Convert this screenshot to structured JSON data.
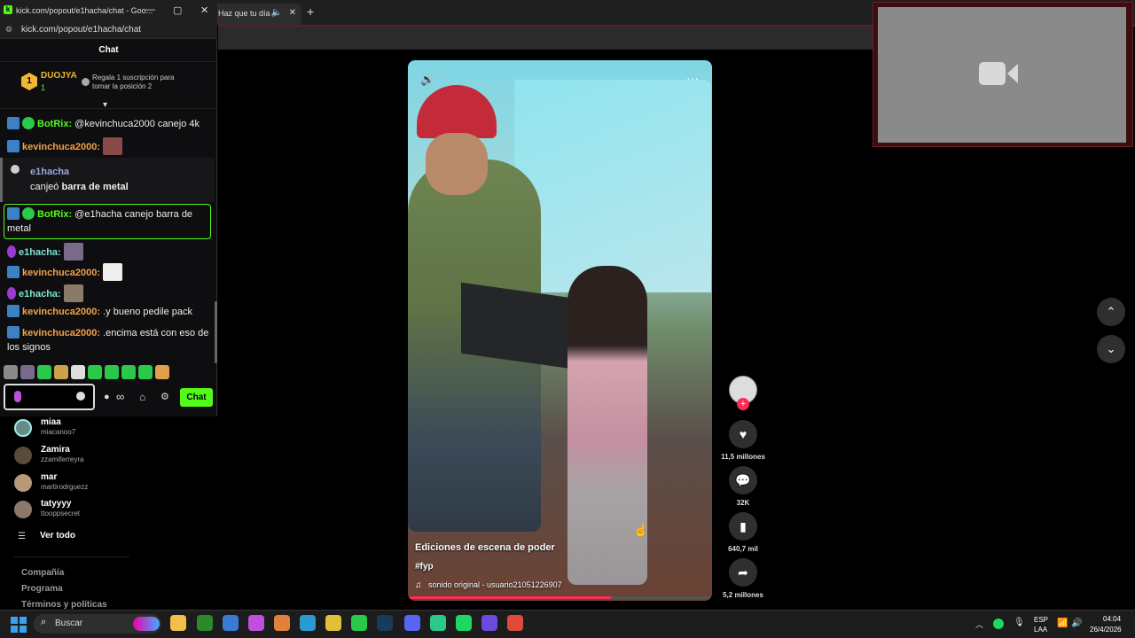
{
  "bg_browser": {
    "tab_title": "Haz que tu día",
    "speaker_icon": "speaker-icon",
    "new_tab_symbol": "+"
  },
  "popup": {
    "window_title": "kick.com/popout/e1hacha/chat - Goo...",
    "url": "kick.com/popout/e1hacha/chat",
    "chat_header": "Chat",
    "pinned": {
      "rank": "1",
      "name": "DUOJYA",
      "count": "1",
      "gift_text": "Regala 1 suscripción para tomar la posición 2"
    },
    "messages": [
      {
        "user": "BotRix",
        "sep": ":",
        "text": " @kevinchuca2000 canejo 4k"
      },
      {
        "user": "kevinchuca2000",
        "sep": ":",
        "text": ""
      },
      {
        "user": "BotRix",
        "sep": ":",
        "text": " @e1hacha canejo barra de metal"
      },
      {
        "user": "e1hacha",
        "sep": ":",
        "text": ""
      },
      {
        "user": "kevinchuca2000",
        "sep": ":",
        "text": ""
      },
      {
        "user": "e1hacha",
        "sep": ":",
        "text": ""
      },
      {
        "user": "kevinchuca2000",
        "sep": ":",
        "text": " .y bueno pedile pack"
      },
      {
        "user": "kevinchuca2000",
        "sep": ":",
        "text": " .encima está con eso de los signos"
      }
    ],
    "redeem": {
      "user": "e1hacha",
      "action": "canjeó ",
      "item": "barra de metal"
    },
    "send_label": "Chat"
  },
  "sidebar": {
    "following": [
      {
        "name": "miaa",
        "handle": "miacanoo7"
      },
      {
        "name": "Zamira",
        "handle": "zzamiferreyra"
      },
      {
        "name": "mar",
        "handle": "martirodrguezz"
      },
      {
        "name": "tatyyyy",
        "handle": "ttooppsecret"
      }
    ],
    "see_all": "Ver todo",
    "footer": [
      "Compañía",
      "Programa",
      "Términos y políticas"
    ]
  },
  "video": {
    "title": "Ediciones de escena de poder",
    "hashtag": "#fyp",
    "sound": "sonido original - usuario21051226907",
    "progress": 0.67,
    "likes": "11,5 millones",
    "comments": "32K",
    "saves": "640,7 mil",
    "shares": "5,2 millones"
  },
  "taskbar": {
    "search_label": "Buscar",
    "lang_top": "ESP",
    "lang_bottom": "LAA",
    "time": "04:04",
    "date": "26/4/2026"
  },
  "colors": {
    "kick_green": "#53fc18",
    "tiktok_red": "#fe2c55",
    "gold": "#f2b632"
  }
}
